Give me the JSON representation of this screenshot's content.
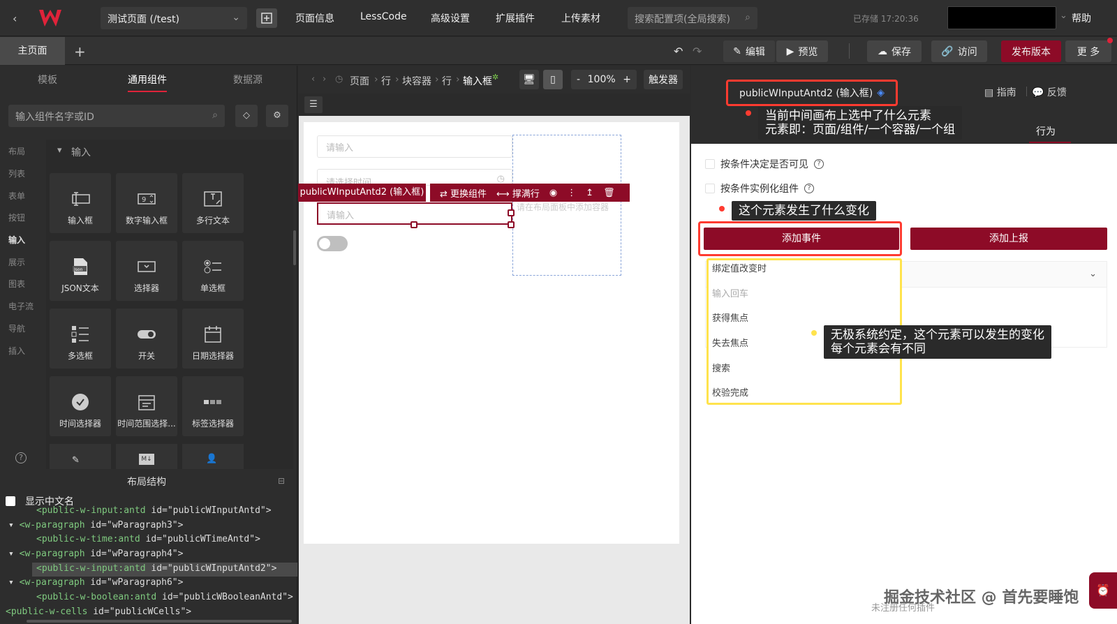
{
  "topbar": {
    "page_select": "测试页面 (/test)",
    "menu": [
      "页面信息",
      "LessCode",
      "高级设置",
      "扩展插件",
      "上传素材"
    ],
    "search_placeholder": "搜索配置项(全局搜索)",
    "saved_status": "已存储 17:20:36",
    "help": "帮助"
  },
  "bar2": {
    "main_tab": "主页面",
    "edit": "编辑",
    "preview": "预览",
    "save": "保存",
    "visit": "访问",
    "publish": "发布版本",
    "more": "更 多"
  },
  "left": {
    "tabs": [
      "模板",
      "通用组件",
      "数据源"
    ],
    "search_placeholder": "输入组件名字或ID",
    "categories": [
      "布局",
      "列表",
      "表单",
      "按钮",
      "输入",
      "展示",
      "图表",
      "电子流",
      "导航",
      "插入"
    ],
    "group_title": "输入",
    "components": [
      "输入框",
      "数字输入框",
      "多行文本",
      "JSON文本",
      "选择器",
      "单选框",
      "多选框",
      "开关",
      "日期选择器",
      "时间选择器",
      "时间范围选择...",
      "标签选择器"
    ],
    "layout_title": "布局结构",
    "show_cn": "显示中文名",
    "tree": [
      {
        "tag": "<public-w-input:antd",
        "attr": " id=",
        "val": "\"publicWInputAntd\">"
      },
      {
        "tag": "<w-paragraph",
        "attr": " id=",
        "val": "\"wParagraph3\">"
      },
      {
        "tag": "<public-w-time:antd",
        "attr": " id=",
        "val": "\"publicWTimeAntd\">"
      },
      {
        "tag": "<w-paragraph",
        "attr": " id=",
        "val": "\"wParagraph4\">"
      },
      {
        "tag": "<public-w-input:antd",
        "attr": " id=",
        "val": "\"publicWInputAntd2\">"
      },
      {
        "tag": "<w-paragraph",
        "attr": " id=",
        "val": "\"wParagraph6\">"
      },
      {
        "tag": "<public-w-boolean:antd",
        "attr": " id=",
        "val": "\"publicWBooleanAntd\">"
      },
      {
        "tag": "<public-w-cells",
        "attr": " id=",
        "val": "\"publicWCells\">"
      }
    ]
  },
  "middle": {
    "crumbs": [
      "页面",
      "行",
      "块容器",
      "行",
      "输入框"
    ],
    "zoom": "100%",
    "trigger": "触发器",
    "input_placeholder": "请输入",
    "time_placeholder": "请选择时间",
    "dashed_hint": "请在布局面板中添加容器",
    "selected_label": "publicWInputAntd2 (输入框)",
    "replace": "更换组件",
    "fill_row": "撑满行"
  },
  "right": {
    "title": "publicWInputAntd2 (输入框)",
    "guide": "指南",
    "feedback": "反馈",
    "tab_behavior": "行为",
    "opt_visible": "按条件决定是否可见",
    "opt_instance": "按条件实例化组件",
    "add_event": "添加事件",
    "add_report": "添加上报",
    "events": [
      "绑定值改变时",
      "输入回车",
      "获得焦点",
      "失去焦点",
      "搜索",
      "校验完成"
    ]
  },
  "notes": {
    "n1_line1": "当前中间画布上选中了什么元素",
    "n1_line2": "元素即：页面/组件/一个容器/一个组",
    "n2": "这个元素发生了什么变化",
    "n3_line1": "无极系统约定，这个元素可以发生的变化",
    "n3_line2": "每个元素会有不同"
  },
  "watermark": "掘金技术社区 @ 首先要睡饱",
  "watermark_sub": "未注册任何插件",
  "colors": {
    "accent": "#8d0b27",
    "annotation_red": "#ff3b30",
    "annotation_yellow": "#ffe34d"
  }
}
